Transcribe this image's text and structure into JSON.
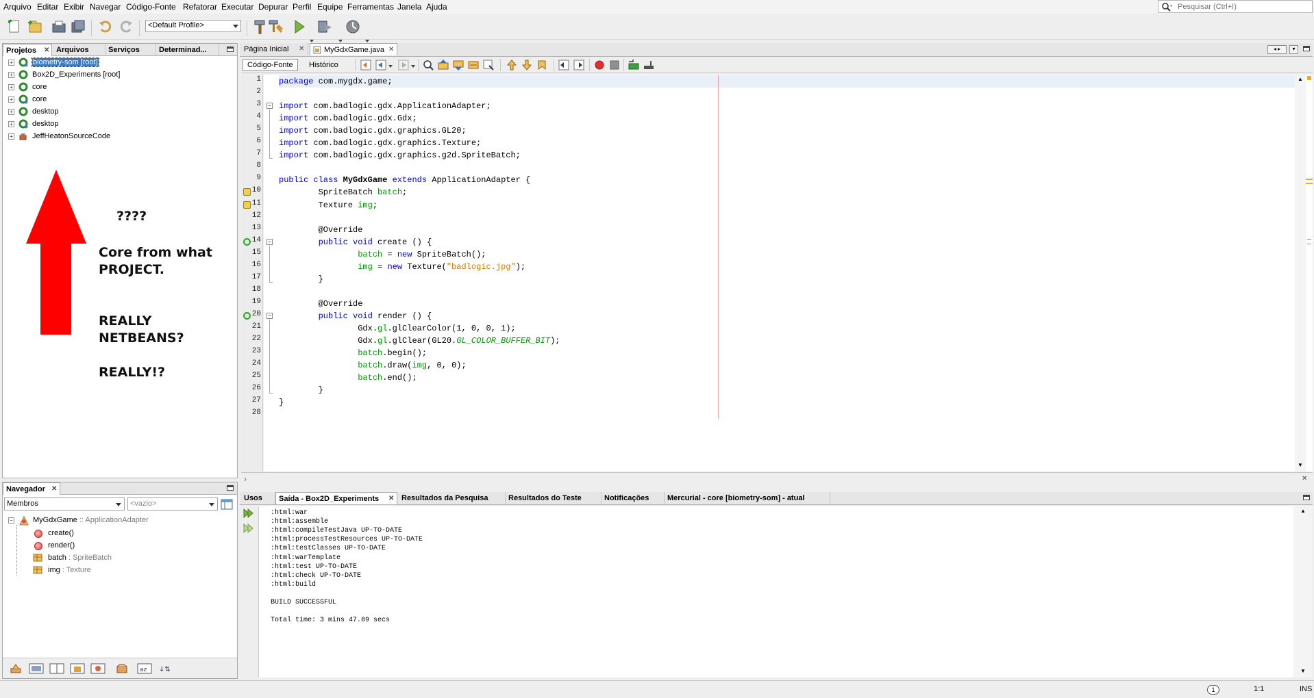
{
  "menu": [
    "Arquivo",
    "Editar",
    "Exibir",
    "Navegar",
    "Código-Fonte",
    "Refatorar",
    "Executar",
    "Depurar",
    "Perfil",
    "Equipe",
    "Ferramentas",
    "Janela",
    "Ajuda"
  ],
  "search": {
    "placeholder": "Pesquisar (Ctrl+I)"
  },
  "toolbar": {
    "profile": "<Default Profile>"
  },
  "projects_panel": {
    "tabs": [
      "Projetos",
      "Arquivos",
      "Serviços",
      "Determinad..."
    ],
    "items": [
      {
        "label": "biometry-som [root]",
        "selected": true
      },
      {
        "label": "Box2D_Experiments [root]",
        "selected": false
      },
      {
        "label": "core",
        "selected": false
      },
      {
        "label": "core",
        "selected": false
      },
      {
        "label": "desktop",
        "selected": false
      },
      {
        "label": "desktop",
        "selected": false
      },
      {
        "label": "JeffHeatonSourceCode",
        "selected": false
      }
    ]
  },
  "annotation": {
    "line1": "????",
    "line2": "Core from what",
    "line3": "PROJECT.",
    "line4": "REALLY",
    "line5": "NETBEANS?",
    "line6": "REALLY!?"
  },
  "editor": {
    "tabs": [
      "Página Inicial",
      "MyGdxGame.java"
    ],
    "subtabs": [
      "Código-Fonte",
      "Histórico"
    ],
    "line_numbers": [
      "1",
      "2",
      "3",
      "4",
      "5",
      "6",
      "7",
      "8",
      "9",
      "10",
      "11",
      "12",
      "13",
      "14",
      "15",
      "16",
      "17",
      "18",
      "19",
      "20",
      "21",
      "22",
      "23",
      "24",
      "25",
      "26",
      "27",
      "28"
    ]
  },
  "navigator": {
    "title": "Navegador",
    "members_select": "Membros",
    "filter_select": "<vazio>",
    "class_name": "MyGdxGame",
    "class_sep": " :: ",
    "class_super": "ApplicationAdapter",
    "methods": [
      "create()",
      "render()"
    ],
    "fields": [
      {
        "name": "batch",
        "sep": " : ",
        "type": "SpriteBatch"
      },
      {
        "name": "img",
        "sep": " : ",
        "type": "Texture"
      }
    ]
  },
  "output": {
    "tabs": [
      "Usos",
      "Saída - Box2D_Experiments",
      "Resultados da Pesquisa",
      "Resultados do Teste",
      "Notificações",
      "Mercurial - core [biometry-som] - atual"
    ],
    "lines": [
      ":html:war",
      ":html:assemble",
      ":html:compileTestJava UP-TO-DATE",
      ":html:processTestResources UP-TO-DATE",
      ":html:testClasses UP-TO-DATE",
      ":html:warTemplate",
      ":html:test UP-TO-DATE",
      ":html:check UP-TO-DATE",
      ":html:build",
      "",
      "BUILD SUCCESSFUL",
      "",
      "Total time: 3 mins 47.89 secs"
    ]
  },
  "status": {
    "notifications": "1",
    "position": "1:1",
    "mode": "INS"
  },
  "colors": {
    "selection": "#3b79c2",
    "keyword": "#0000e6",
    "field": "#009900",
    "string": "#ce7b00",
    "arrow": "#ff0000"
  }
}
